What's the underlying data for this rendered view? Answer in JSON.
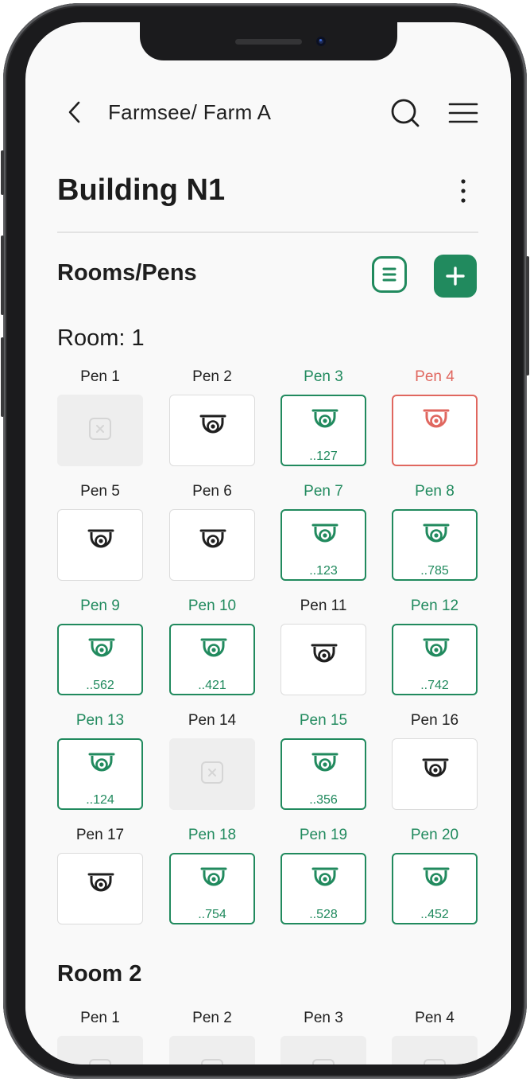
{
  "header": {
    "breadcrumb": "Farmsee/ Farm A",
    "page_title": "Building N1"
  },
  "section": {
    "title": "Rooms/Pens"
  },
  "icons": {
    "back": "chevron-left-icon",
    "search": "search-icon",
    "menu": "hamburger-menu-icon",
    "more": "vertical-dots-icon",
    "list": "list-icon",
    "add": "plus-icon",
    "camera": "security-camera-icon",
    "unavailable": "x-box-icon"
  },
  "colors": {
    "accent": "#218a5e",
    "alert": "#e0675f",
    "disabled": "#eeeeee",
    "text": "#1f1f1f"
  },
  "rooms": [
    {
      "title": "Room: 1",
      "pens": [
        {
          "label": "Pen 1",
          "status": "disabled",
          "code": ""
        },
        {
          "label": "Pen 2",
          "status": "idle",
          "code": ""
        },
        {
          "label": "Pen 3",
          "status": "active",
          "code": "..127"
        },
        {
          "label": "Pen 4",
          "status": "alert",
          "code": ""
        },
        {
          "label": "Pen 5",
          "status": "idle",
          "code": ""
        },
        {
          "label": "Pen 6",
          "status": "idle",
          "code": ""
        },
        {
          "label": "Pen 7",
          "status": "active",
          "code": "..123"
        },
        {
          "label": "Pen 8",
          "status": "active",
          "code": "..785"
        },
        {
          "label": "Pen 9",
          "status": "active",
          "code": "..562"
        },
        {
          "label": "Pen 10",
          "status": "active",
          "code": "..421"
        },
        {
          "label": "Pen 11",
          "status": "idle",
          "code": ""
        },
        {
          "label": "Pen 12",
          "status": "active",
          "code": "..742"
        },
        {
          "label": "Pen 13",
          "status": "active",
          "code": "..124"
        },
        {
          "label": "Pen 14",
          "status": "disabled",
          "code": ""
        },
        {
          "label": "Pen 15",
          "status": "active",
          "code": "..356"
        },
        {
          "label": "Pen 16",
          "status": "idle",
          "code": ""
        },
        {
          "label": "Pen 17",
          "status": "idle",
          "code": ""
        },
        {
          "label": "Pen 18",
          "status": "active",
          "code": "..754"
        },
        {
          "label": "Pen 19",
          "status": "active",
          "code": "..528"
        },
        {
          "label": "Pen 20",
          "status": "active",
          "code": "..452"
        }
      ]
    },
    {
      "title": "Room 2",
      "pens": [
        {
          "label": "Pen 1",
          "status": "disabled",
          "code": ""
        },
        {
          "label": "Pen 2",
          "status": "disabled",
          "code": ""
        },
        {
          "label": "Pen 3",
          "status": "disabled",
          "code": ""
        },
        {
          "label": "Pen 4",
          "status": "disabled",
          "code": ""
        }
      ]
    }
  ]
}
